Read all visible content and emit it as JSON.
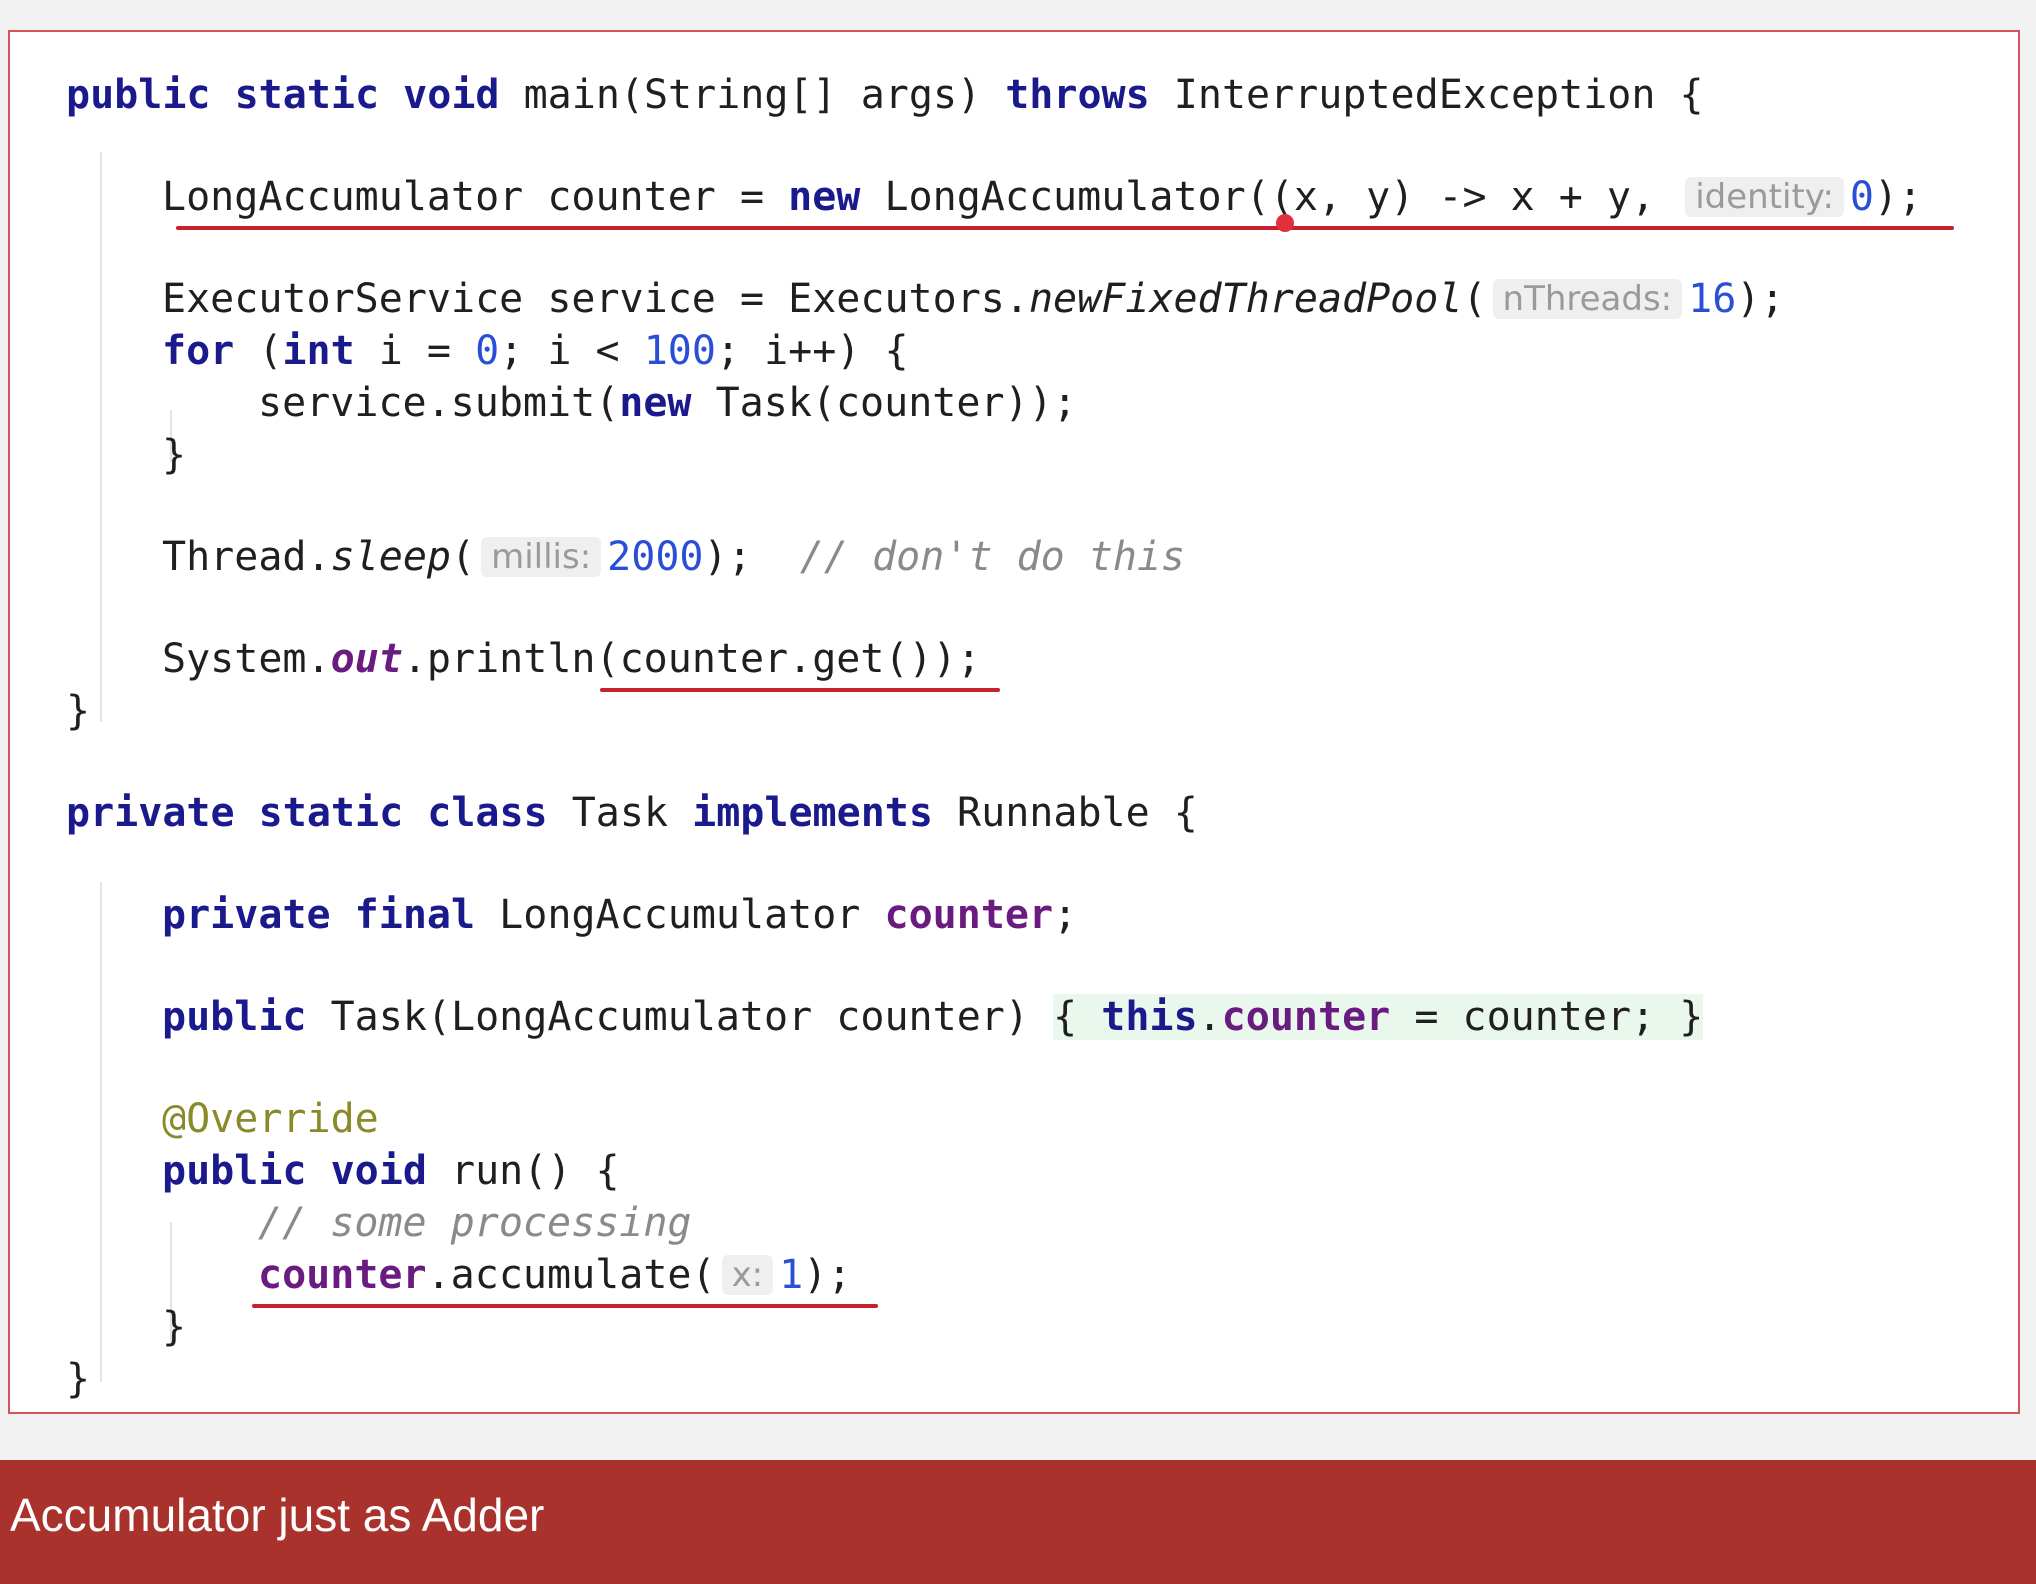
{
  "code": {
    "main_kw": "public static void",
    "main_sig": " main(String[] args) ",
    "throws_kw": "throws",
    "main_tail": " InterruptedException {",
    "acc_decl": "LongAccumulator counter = ",
    "new_kw": "new",
    "acc_ctor": " LongAccumulator((x, y) -> x + y, ",
    "identity_hint": "identity:",
    "identity_val": "0",
    "acc_end": ");",
    "svc_decl": "ExecutorService service = Executors.",
    "svc_method": "newFixedThreadPool",
    "svc_paren": "(",
    "nthreads_hint": "nThreads:",
    "nthreads_val": "16",
    "svc_end": ");",
    "for_kw": "for",
    "for_open": " (",
    "int_kw": "int",
    "for_mid": " i = ",
    "for_zero": "0",
    "for_cond": "; i < ",
    "for_hundred": "100",
    "for_end": "; i++) {",
    "submit_pre": "service.submit(",
    "submit_new": "new",
    "submit_post": " Task(counter));",
    "close_brace": "}",
    "sleep_pre": "Thread.",
    "sleep_method": "sleep",
    "sleep_paren": "(",
    "millis_hint": "millis:",
    "millis_val": "2000",
    "sleep_end": ");  ",
    "sleep_comment": "// don't do this",
    "println_pre": "System.",
    "println_out": "out",
    "println_post": ".println(counter.get());",
    "task_kw": "private static class",
    "task_name": " Task ",
    "implements_kw": "implements",
    "task_tail": " Runnable {",
    "field_kw": "private final",
    "field_type": " LongAccumulator ",
    "field_name": "counter",
    "field_end": ";",
    "ctor_kw": "public",
    "ctor_sig": " Task(LongAccumulator counter) ",
    "ctor_open": "{",
    "ctor_space1": " ",
    "this_kw": "this",
    "ctor_dot": ".",
    "ctor_field": "counter",
    "ctor_assign": " = counter; ",
    "ctor_close": "}",
    "override": "@Override",
    "run_kw": "public void",
    "run_sig": " run() {",
    "run_comment": "// some processing",
    "acc_field": "counter",
    "acc_call": ".accumulate(",
    "x_hint": "x:",
    "x_val": "1",
    "acc_call_end": ");"
  },
  "caption": "Accumulator just as Adder"
}
